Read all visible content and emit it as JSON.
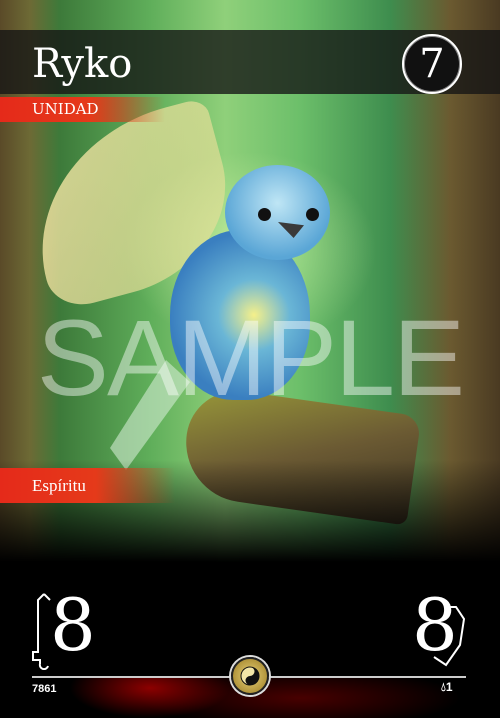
{
  "card": {
    "name": "Ryko",
    "cost": "7",
    "type": "UNIDAD",
    "subtype": "Espíritu",
    "attack": "8",
    "defense": "8",
    "code": "7861",
    "rarity_count": "1",
    "watermark": "SAMPLE",
    "icons": {
      "attack": "sword-icon",
      "defense": "shield-icon",
      "emblem": "yin-yang-icon",
      "rarity": "drop-icon"
    },
    "colors": {
      "accent": "#e52a1a",
      "emblem": "#c9a53a"
    }
  }
}
